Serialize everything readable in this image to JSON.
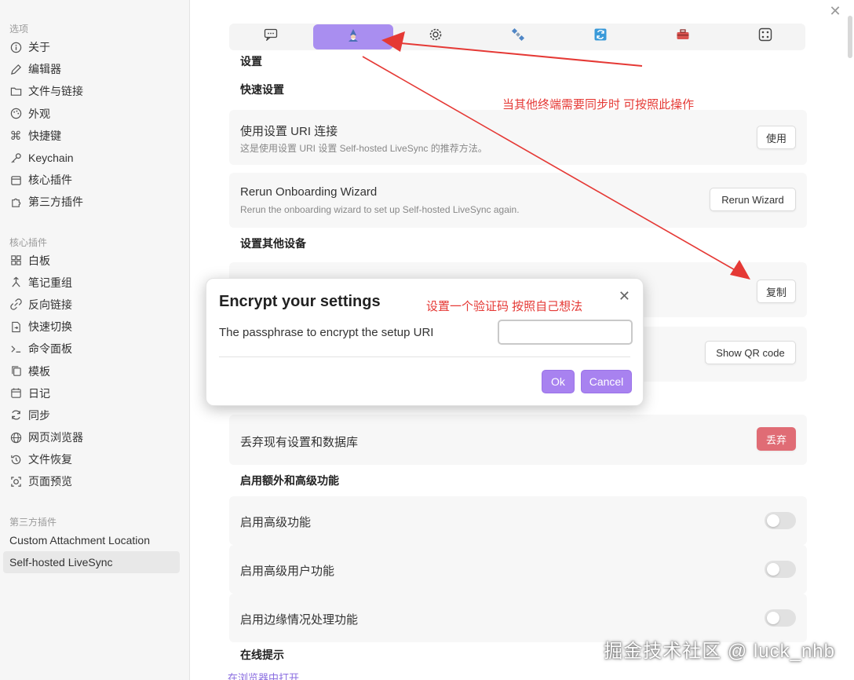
{
  "sidebar": {
    "group1_title": "选项",
    "options": [
      {
        "label": "关于",
        "icon": "info-icon"
      },
      {
        "label": "编辑器",
        "icon": "pencil-icon"
      },
      {
        "label": "文件与链接",
        "icon": "folder-link-icon"
      },
      {
        "label": "外观",
        "icon": "palette-icon"
      },
      {
        "label": "快捷键",
        "icon": "command-icon"
      },
      {
        "label": "Keychain",
        "icon": "key-icon"
      },
      {
        "label": "核心插件",
        "icon": "calendar-box-icon"
      },
      {
        "label": "第三方插件",
        "icon": "puzzle-icon"
      }
    ],
    "group2_title": "核心插件",
    "core_plugins": [
      {
        "label": "白板",
        "icon": "grid-icon"
      },
      {
        "label": "笔记重组",
        "icon": "merge-icon"
      },
      {
        "label": "反向链接",
        "icon": "backlink-icon"
      },
      {
        "label": "快速切换",
        "icon": "file-switch-icon"
      },
      {
        "label": "命令面板",
        "icon": "terminal-icon"
      },
      {
        "label": "模板",
        "icon": "copy-icon"
      },
      {
        "label": "日记",
        "icon": "calendar-icon"
      },
      {
        "label": "同步",
        "icon": "sync-icon"
      },
      {
        "label": "网页浏览器",
        "icon": "globe-icon"
      },
      {
        "label": "文件恢复",
        "icon": "history-icon"
      },
      {
        "label": "页面预览",
        "icon": "preview-icon"
      }
    ],
    "group3_title": "第三方插件",
    "third_party": [
      {
        "label": "Custom Attachment Location"
      },
      {
        "label": "Self-hosted LiveSync"
      }
    ]
  },
  "tabs": [
    {
      "icon": "chat-icon"
    },
    {
      "icon": "wizard-icon"
    },
    {
      "icon": "gear-icon"
    },
    {
      "icon": "satellite-icon"
    },
    {
      "icon": "sync-box-icon"
    },
    {
      "icon": "toolbox-icon"
    },
    {
      "icon": "dice-icon"
    }
  ],
  "content": {
    "heading": "设置",
    "quick_setup_title": "快速设置",
    "uri_connect": {
      "name": "使用设置 URI 连接",
      "desc": "这是使用设置 URI 设置 Self-hosted LiveSync 的推荐方法。",
      "button": "使用"
    },
    "rerun": {
      "name": "Rerun Onboarding Wizard",
      "desc": "Rerun the onboarding wizard to set up Self-hosted LiveSync again.",
      "button": "Rerun Wizard"
    },
    "other_devices_title": "设置其他设备",
    "copy_button": "复制",
    "qr_button": "Show QR code",
    "discard": {
      "name": "丢弃现有设置和数据库",
      "button": "丢弃"
    },
    "advanced_title": "启用额外和高级功能",
    "toggles": [
      {
        "name": "启用高级功能"
      },
      {
        "name": "启用高级用户功能"
      },
      {
        "name": "启用边缘情况处理功能"
      }
    ],
    "online_tips_title": "在线提示",
    "bottom_link": "在浏览器中打开"
  },
  "annotations": {
    "sync_note": "当其他终端需要同步时  可按照此操作",
    "passphrase_note": "设置一个验证码 按照自己想法",
    "arrow_color": "#e53935"
  },
  "modal": {
    "title": "Encrypt your settings",
    "label": "The passphrase to encrypt the setup URI",
    "input_value": "",
    "ok": "Ok",
    "cancel": "Cancel"
  },
  "watermark": "掘金技术社区 @ luck_nhb",
  "colors": {
    "accent": "#a98ef0",
    "danger": "#e06c75"
  }
}
